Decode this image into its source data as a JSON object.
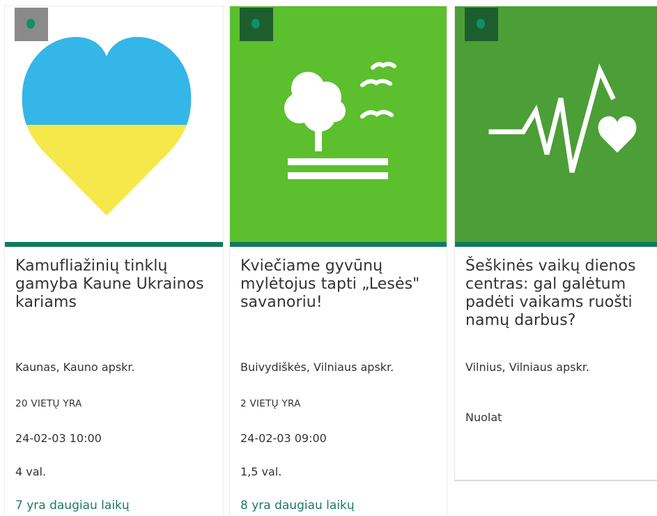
{
  "cards": [
    {
      "title": "Kamufliažinių tinklų gamyba Kaune Ukrainos kariams",
      "location": "Kaunas, Kauno apskr.",
      "places": "20 VIETŲ YRA",
      "datetime": "24-02-03 10:00",
      "duration": "4 val.",
      "more_times": "7 yra daugiau laikų",
      "image_icon": "heart-ukraine-icon",
      "image_bg": "#ffffff"
    },
    {
      "title": "Kviečiame gyvūnų mylėtojus tapti „Lesės\" savanoriu!",
      "location": "Buivydiškės, Vilniaus apskr.",
      "places": "2 VIETŲ YRA",
      "datetime": "24-02-03 09:00",
      "duration": "1,5 val.",
      "more_times": "8 yra daugiau laikų",
      "image_icon": "tree-birds-icon",
      "image_bg": "#5bbf2e"
    },
    {
      "title": "Šeškinės vaikų dienos centras: gal galėtum padėti vaikams ruošti namų darbus?",
      "location": "Vilnius, Vilniaus apskr.",
      "schedule": "Nuolat",
      "image_icon": "heartbeat-heart-icon",
      "image_bg": "#4c9e36"
    }
  ],
  "colors": {
    "accent_bar": "#117a5e",
    "more_link": "#1c7a62",
    "ukraine_blue": "#34b6e8",
    "ukraine_yellow": "#f5e84a"
  }
}
